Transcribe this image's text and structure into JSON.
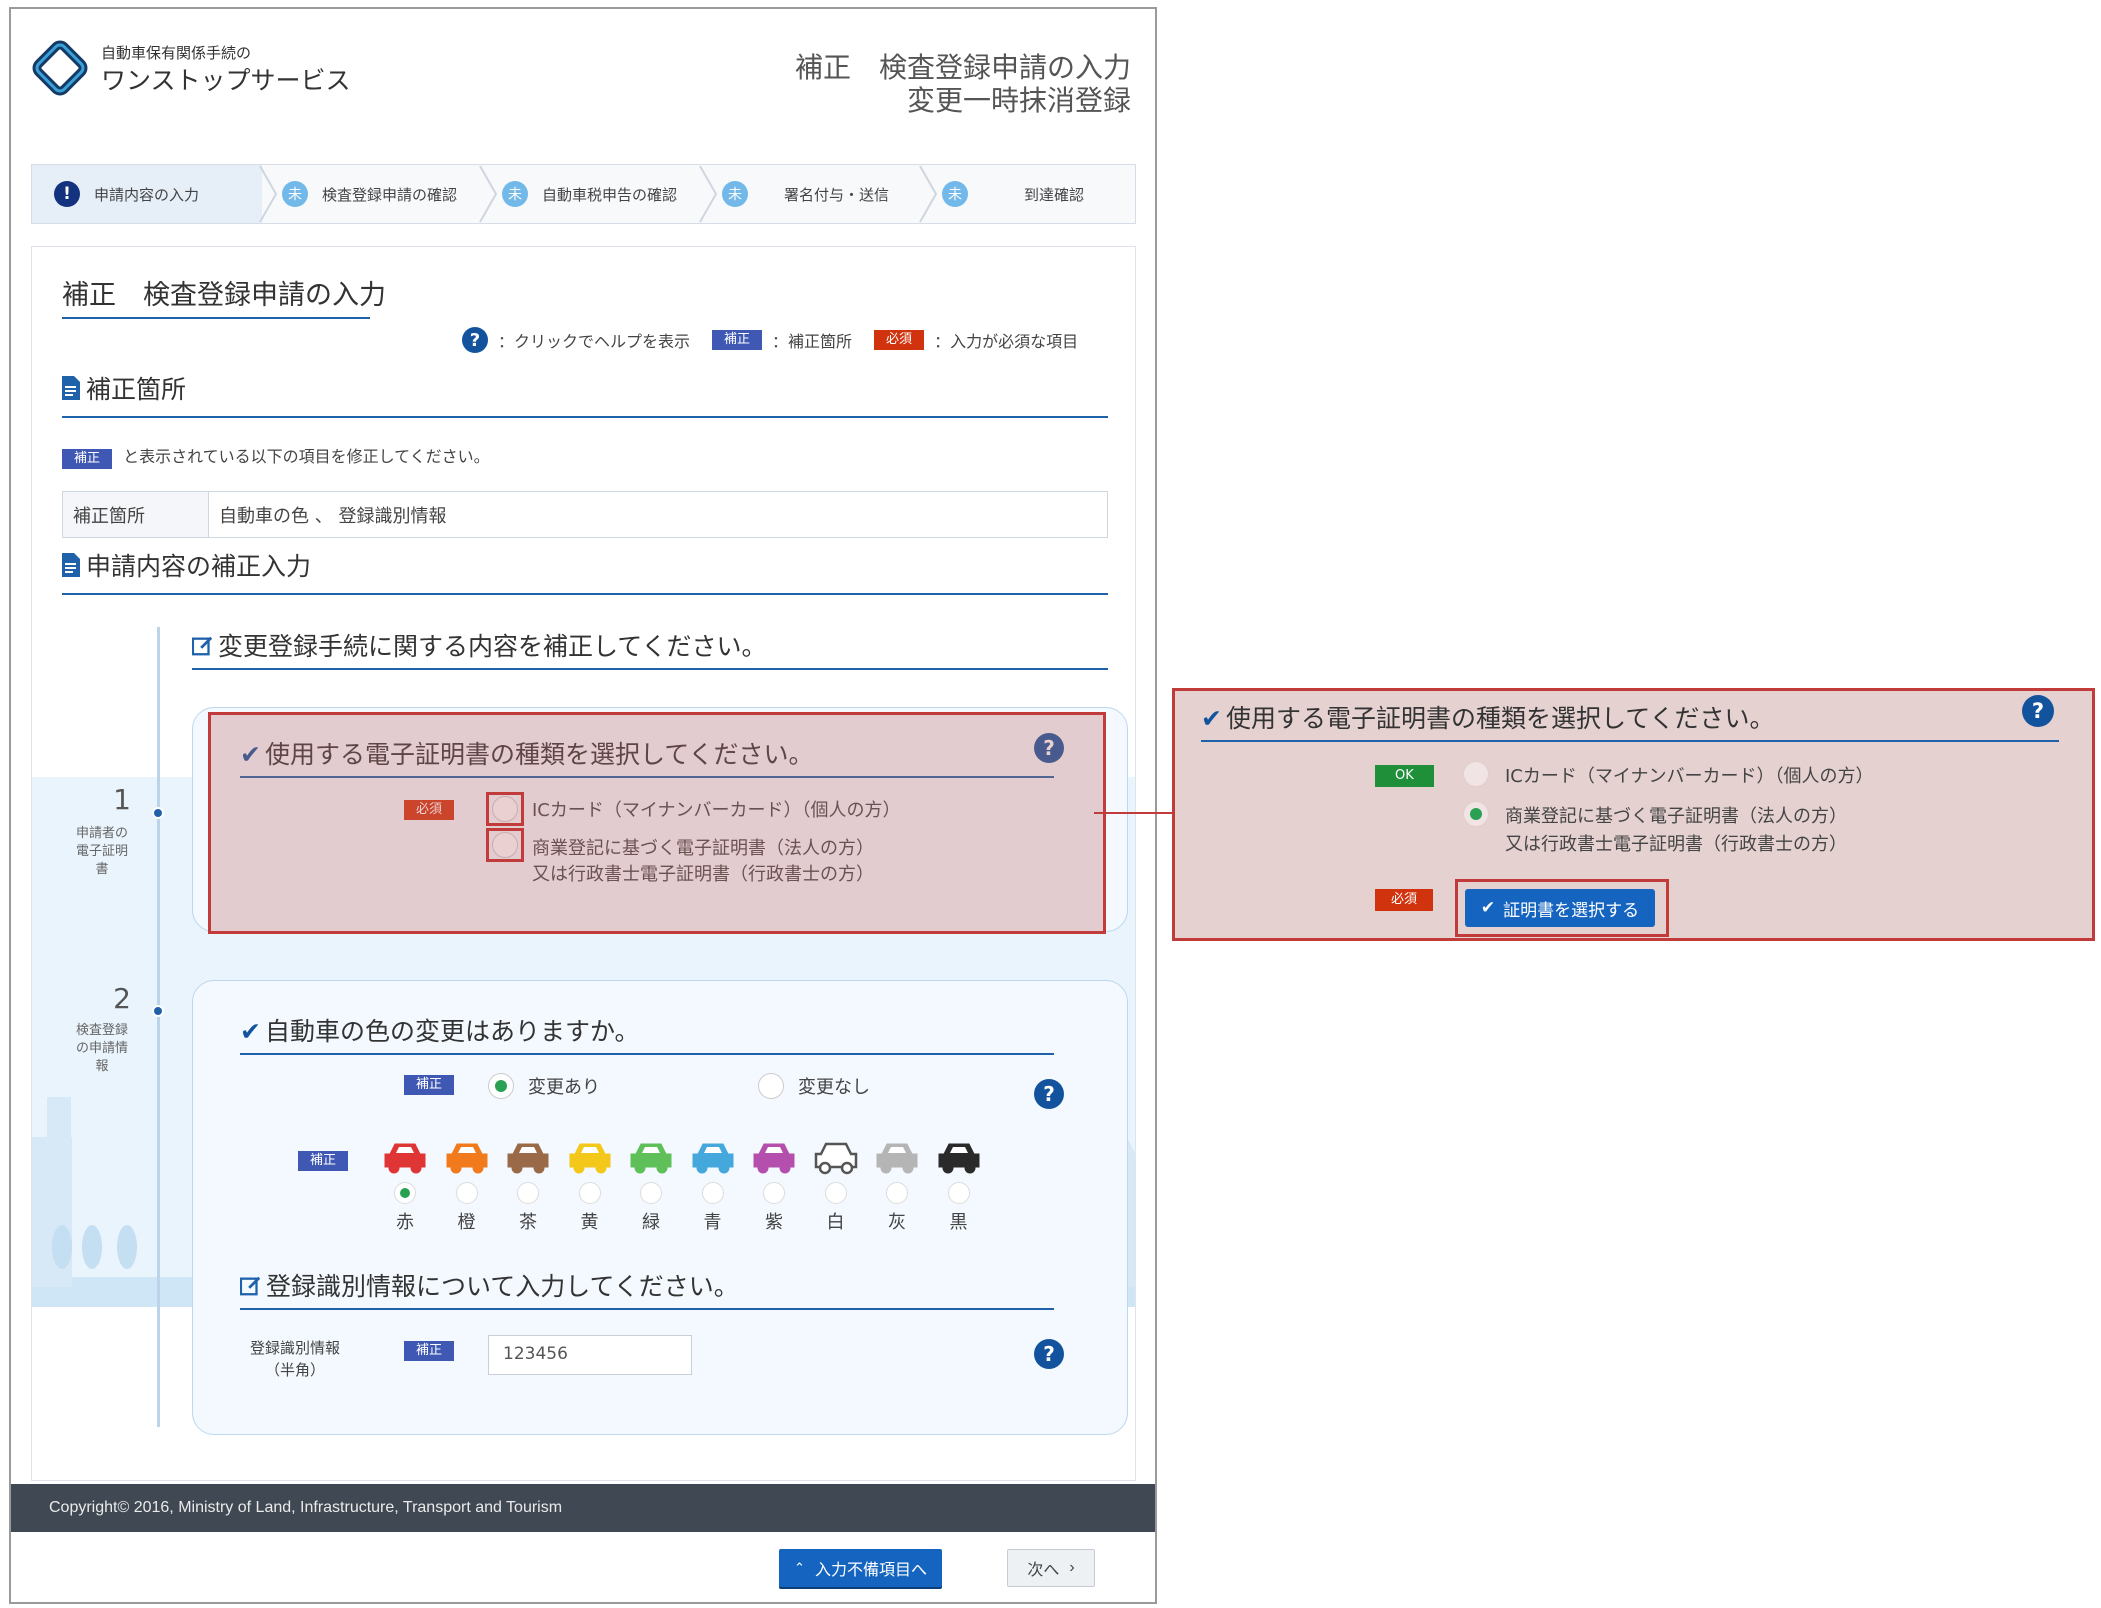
{
  "header": {
    "logo_sub": "自動車保有関係手続の",
    "logo_main": "ワンストップサービス",
    "title_line1": "補正　検査登録申請の入力",
    "title_line2": "変更一時抹消登録"
  },
  "steps": [
    {
      "label": "申請内容の入力",
      "icon": "!",
      "state": "current"
    },
    {
      "label": "検査登録申請の確認",
      "icon": "未",
      "state": "todo"
    },
    {
      "label": "自動車税申告の確認",
      "icon": "未",
      "state": "todo"
    },
    {
      "label": "署名付与・送信",
      "icon": "未",
      "state": "todo"
    },
    {
      "label": "到達確認",
      "icon": "未",
      "state": "todo"
    }
  ],
  "page": {
    "title": "補正　検査登録申請の入力",
    "legend_help": "：クリックでヘルプを表示",
    "legend_hosei_badge": "補正",
    "legend_hosei_text": "：補正箇所",
    "legend_hissu_badge": "必須",
    "legend_hissu_text": "：入力が必須な項目"
  },
  "section_fix": {
    "title": "補正箇所",
    "note_badge": "補正",
    "note": "と表示されている以下の項目を修正してください。",
    "table_key": "補正箇所",
    "table_value": "自動車の色 、 登録識別情報"
  },
  "section_input": {
    "title": "申請内容の補正入力",
    "subtitle": "変更登録手続に関する内容を補正してください。"
  },
  "item1": {
    "number": "1",
    "side_label": "申請者の電子証明書",
    "question": "使用する電子証明書の種類を選択してください。",
    "required_badge": "必須",
    "opt1": "ICカード（マイナンバーカード）（個人の方）",
    "opt2_line1": "商業登記に基づく電子証明書（法人の方）",
    "opt2_line2": "又は行政書士電子証明書（行政書士の方）"
  },
  "item2": {
    "number": "2",
    "side_label": "検査登録の申請情報",
    "question": "自動車の色の変更はありますか。",
    "badge": "補正",
    "opt_yes": "変更あり",
    "opt_no": "変更なし",
    "selected": "変更あり",
    "color_badge": "補正",
    "colors": [
      {
        "label": "赤",
        "hex": "#e03535"
      },
      {
        "label": "橙",
        "hex": "#f07a1c"
      },
      {
        "label": "茶",
        "hex": "#9a6a48"
      },
      {
        "label": "黄",
        "hex": "#f4c81a"
      },
      {
        "label": "緑",
        "hex": "#5fc05a"
      },
      {
        "label": "青",
        "hex": "#45a8dc"
      },
      {
        "label": "紫",
        "hex": "#b54fae"
      },
      {
        "label": "白",
        "hex": "#ffffff"
      },
      {
        "label": "灰",
        "hex": "#b5b5b5"
      },
      {
        "label": "黒",
        "hex": "#2a2a2a"
      }
    ],
    "selected_color": "赤",
    "reg_title": "登録識別情報について入力してください。",
    "reg_label_line1": "登録識別情報",
    "reg_label_line2": "（半角）",
    "reg_badge": "補正",
    "reg_value": "123456"
  },
  "footer": {
    "copyright": "Copyright© 2016, Ministry of Land, Infrastructure, Transport and Tourism",
    "btn_incomplete": "入力不備項目へ",
    "btn_next": "次へ"
  },
  "zoom": {
    "question": "使用する電子証明書の種類を選択してください。",
    "ok_badge": "OK",
    "opt1": "ICカード（マイナンバーカード）（個人の方）",
    "opt2_line1": "商業登記に基づく電子証明書（法人の方）",
    "opt2_line2": "又は行政書士電子証明書（行政書士の方）",
    "selected": "opt2",
    "required_badge": "必須",
    "btn_cert": "証明書を選択する"
  },
  "colors": {
    "accent": "#1565c0",
    "underline": "#1f62a9",
    "hosei_badge": "#3f58b3",
    "hissu_badge": "#d1330f",
    "ok_badge": "#1f8f3a",
    "highlight_border": "#c13b3b",
    "footer_bg": "#404953"
  }
}
